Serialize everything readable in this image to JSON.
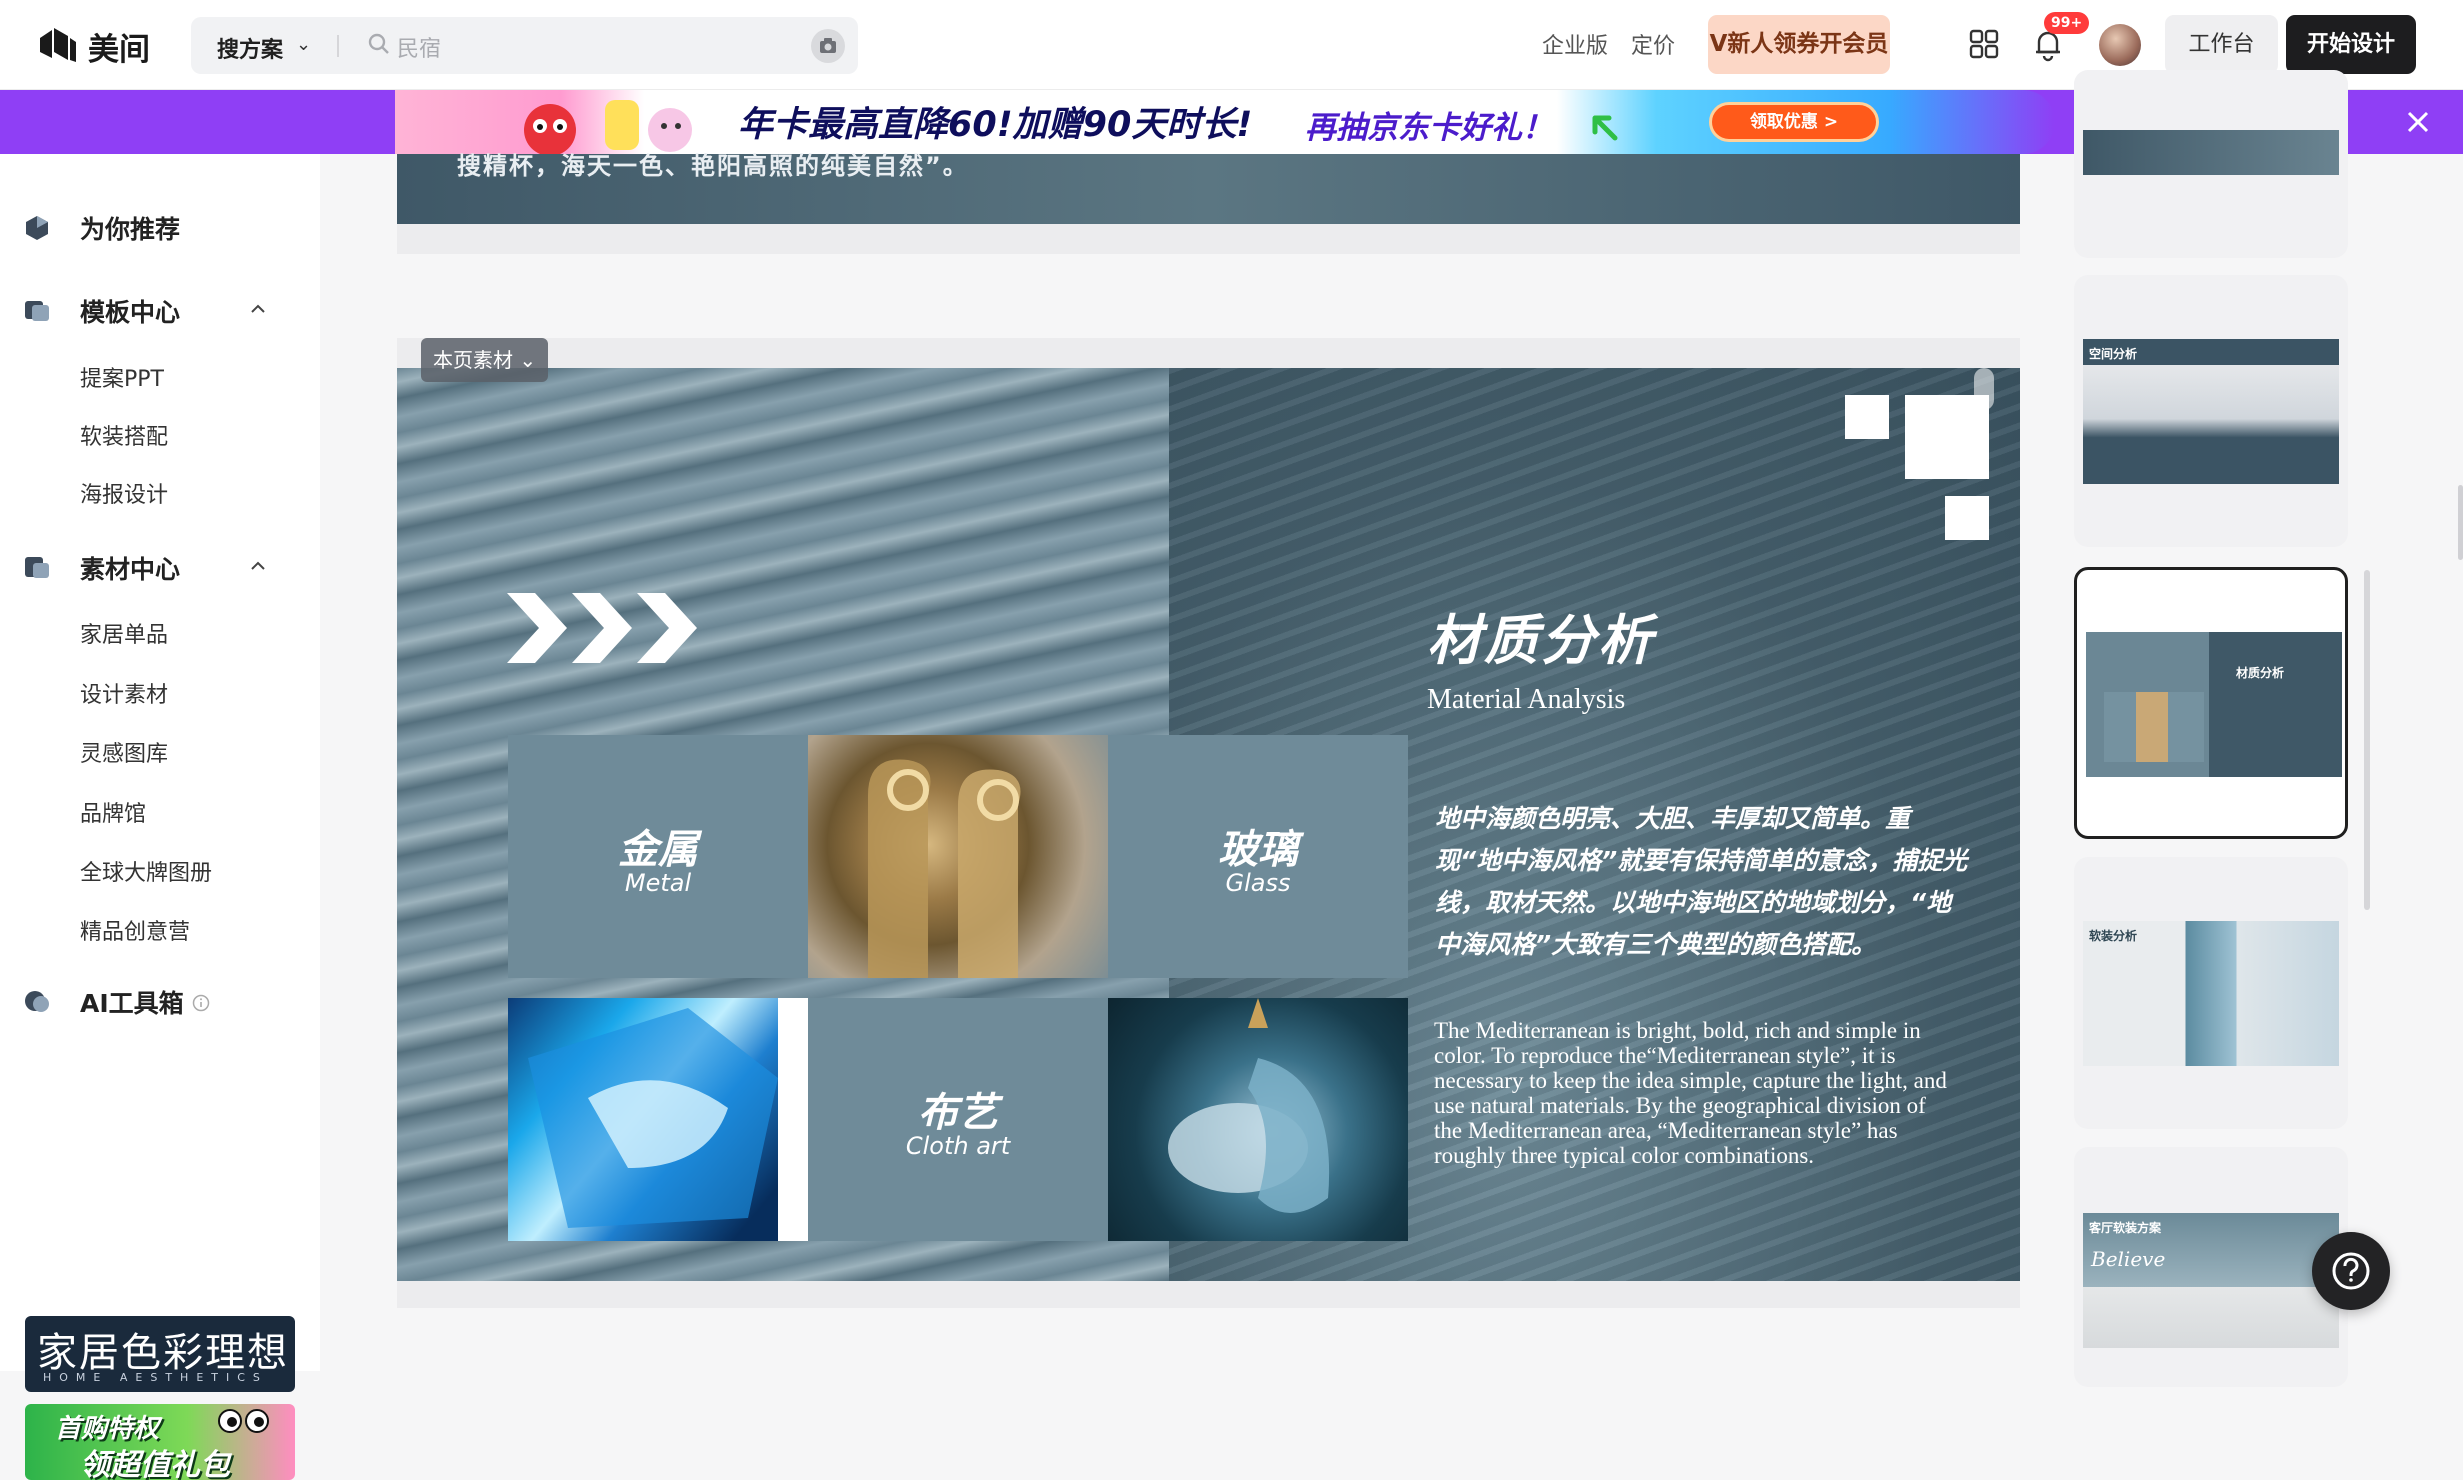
{
  "header": {
    "logo_text": "美间",
    "search_type": "搜方案",
    "search_placeholder": "民宿",
    "links": [
      "企业版",
      "定价"
    ],
    "vip_label": "V新人领券开会员",
    "notification_badge": "99+",
    "workbench_label": "工作台",
    "start_design_label": "开始设计"
  },
  "banner": {
    "text_main": "年卡最高直降60!加赠90天时长!",
    "text_sub": "再抽京东卡好礼！",
    "button_label": "领取优惠 >"
  },
  "sidebar": {
    "recommend_label": "为你推荐",
    "template_center_label": "模板中心",
    "template_items": [
      "提案PPT",
      "软装搭配",
      "海报设计"
    ],
    "material_center_label": "素材中心",
    "material_items": [
      "家居单品",
      "设计素材",
      "灵感图库",
      "品牌馆",
      "全球大牌图册",
      "精品创意营"
    ],
    "ai_tools_label": "AI工具箱",
    "promo1_title": "家居色彩理想国",
    "promo1_sub": "HOME AESTHETICS",
    "promo2_line1": "首购特权",
    "promo2_line2": "领超值礼包"
  },
  "previous_slide": {
    "partial_text": "搜精杯，海天一色、艳阳高照的纯美自然”。"
  },
  "slide": {
    "material_tag": "本页素材",
    "title_cn": "材质分析",
    "title_en": "Material Analysis",
    "tiles": [
      {
        "cn": "金属",
        "en": "Metal"
      },
      {
        "cn": "玻璃",
        "en": "Glass"
      },
      {
        "cn": "布艺",
        "en": "Cloth art"
      }
    ],
    "body_cn": "地中海颜色明亮、大胆、丰厚却又简单。重现“地中海风格”就要有保持简单的意念，捕捉光线，取材天然。以地中海地区的地域划分，“地中海风格”大致有三个典型的颜色搭配。",
    "body_en": "The Mediterranean is bright, bold, rich and simple in color. To reproduce the“Mediterranean style”, it is necessary to keep the idea simple, capture the light, and use natural materials. By the geographical division of the Mediterranean area, “Mediterranean style” has roughly three typical color combinations."
  },
  "thumbnails": {
    "labels": [
      "",
      "空间分析",
      "材质分析",
      "软装分析",
      "客厅软装方案"
    ],
    "believe": "Believe",
    "selected_index": 2
  },
  "colors": {
    "accent": "#8f3ff5",
    "slide_bg": "#4d6877",
    "material_tile": "#6f8b99",
    "dark_button": "#1d1d1f"
  }
}
